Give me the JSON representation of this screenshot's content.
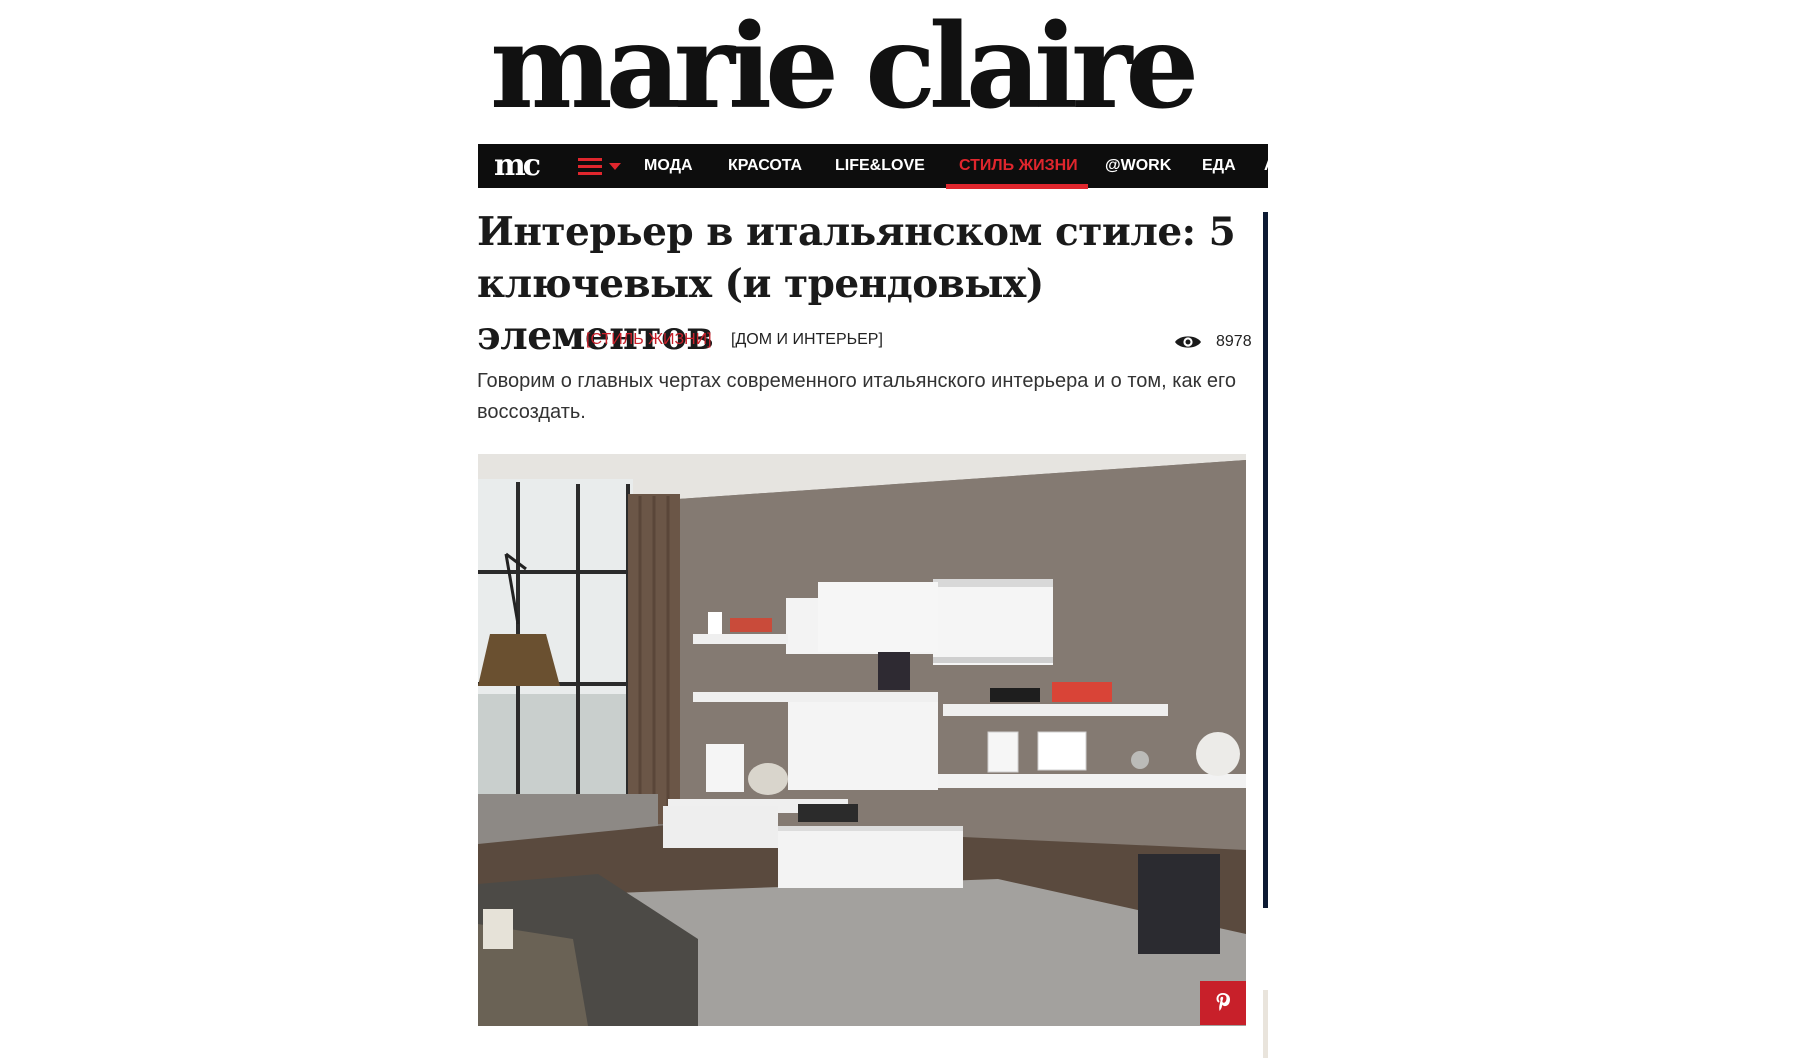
{
  "header": {
    "logo_text": "marie claire"
  },
  "nav": {
    "brand": "mc",
    "items": [
      {
        "label": "МОДА",
        "active": false
      },
      {
        "label": "КРАСОТА",
        "active": false
      },
      {
        "label": "LIFE&LOVE",
        "active": false
      },
      {
        "label": "СТИЛЬ ЖИЗНИ",
        "active": true
      },
      {
        "label": "@WORK",
        "active": false
      },
      {
        "label": "ЕДА",
        "active": false
      },
      {
        "label": "А",
        "active": false
      }
    ],
    "accent_color": "#e0262d",
    "background_color": "#0d0d0d"
  },
  "article": {
    "title_line1": "Интерьер в итальянском стиле: 5",
    "title_line2": "ключевых (и трендовых) элементов",
    "tags": [
      "[СТИЛЬ ЖИЗНИ]",
      "[ДОМ И ИНТЕРЬЕР]"
    ],
    "views": "8978",
    "lead": "Говорим о главных чертах современного итальянского интерьера и о том, как его воссоздать."
  },
  "icons": {
    "menu": "hamburger-icon",
    "views": "eye-icon",
    "share": "pinterest-icon"
  }
}
